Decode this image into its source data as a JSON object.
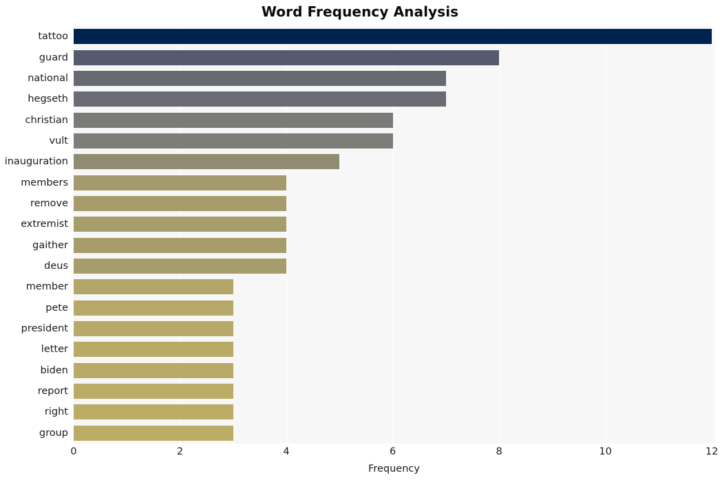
{
  "chart_data": {
    "type": "bar",
    "orientation": "horizontal",
    "title": "Word Frequency Analysis",
    "xlabel": "Frequency",
    "ylabel": "",
    "xlim": [
      0,
      12.05
    ],
    "xticks": [
      0,
      2,
      4,
      6,
      8,
      10,
      12
    ],
    "xtick_labels": [
      "0",
      "2",
      "4",
      "6",
      "8",
      "10",
      "12"
    ],
    "grid": "vertical-white-on-gray",
    "legend": "none",
    "categories": [
      "tattoo",
      "guard",
      "national",
      "hegseth",
      "christian",
      "vult",
      "inauguration",
      "members",
      "remove",
      "extremist",
      "gaither",
      "deus",
      "member",
      "pete",
      "president",
      "letter",
      "biden",
      "report",
      "right",
      "group"
    ],
    "values": [
      12,
      8,
      7,
      7,
      6,
      6,
      5,
      4,
      4,
      4,
      4,
      4,
      3,
      3,
      3,
      3,
      3,
      3,
      3,
      3
    ],
    "bar_colors": [
      "#00224e",
      "#565a6e",
      "#676a72",
      "#6b6c73",
      "#7a7a78",
      "#7e7d77",
      "#908c72",
      "#a49a6d",
      "#a79c6c",
      "#a79c6c",
      "#a79c6c",
      "#a79c6c",
      "#b4a669",
      "#b6a868",
      "#b7a968",
      "#b8aa67",
      "#b9ab67",
      "#baac67",
      "#bbac66",
      "#bcad66"
    ],
    "colormap": "cividis",
    "plot_background": "#f7f7f7",
    "figure_background": "#ffffff",
    "grid_color": "#ffffff",
    "text_color": "#1a1a1a"
  }
}
